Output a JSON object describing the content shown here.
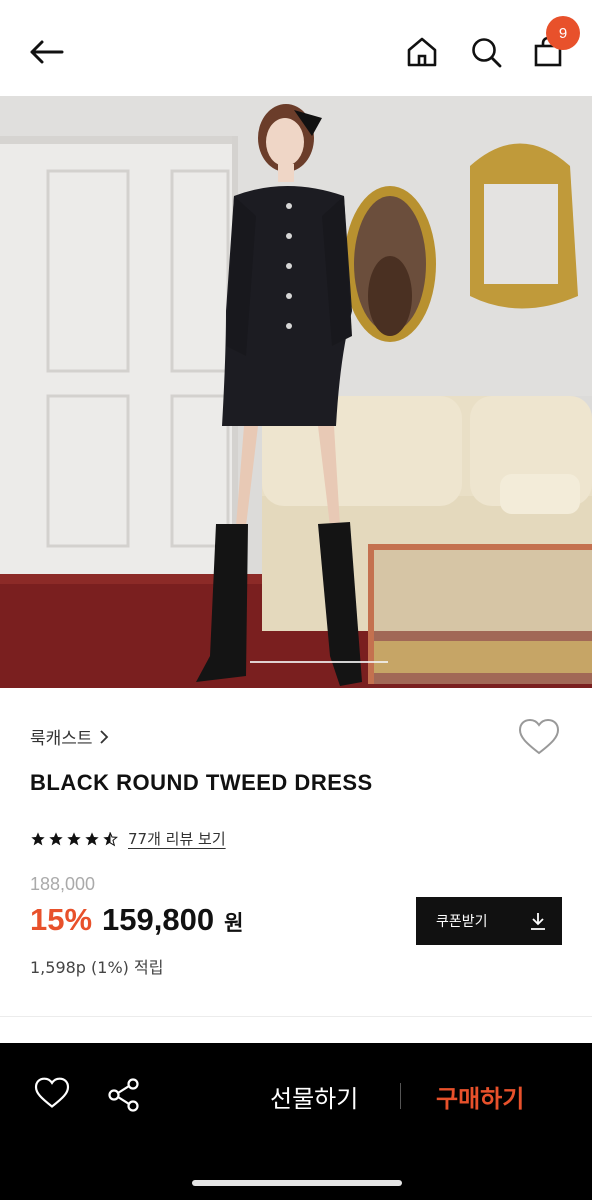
{
  "header": {
    "back_icon": "back-arrow-icon",
    "home_icon": "home-icon",
    "search_icon": "search-icon",
    "bag_icon": "shopping-bag-icon",
    "bag_count": "9",
    "badge_color": "#e8512b"
  },
  "hero": {
    "carousel_position": 0.67
  },
  "product": {
    "brand": "룩캐스트",
    "brand_chevron": "chevron-right-icon",
    "title": "BLACK ROUND TWEED DRESS",
    "rating_value": 4.5,
    "review_link": "77개 리뷰 보기",
    "original_price": "188,000",
    "discount": "15%",
    "sale_price": "159,800",
    "currency": "원",
    "points": "1,598p (1%) 적립",
    "coupon_label": "쿠폰받기",
    "coupon_icon": "download-icon",
    "wish_icon": "heart-outline-icon"
  },
  "bottom_bar": {
    "heart_icon": "heart-outline-icon",
    "share_icon": "share-icon",
    "gift_label": "선물하기",
    "buy_label": "구매하기",
    "buy_color": "#e8512b"
  }
}
